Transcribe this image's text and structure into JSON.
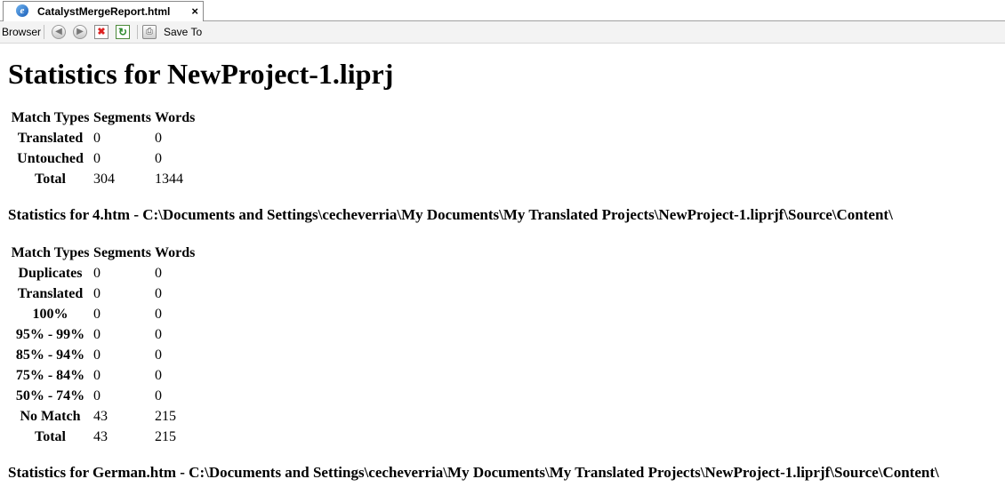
{
  "tab": {
    "title": "CatalystMergeReport.html",
    "close_glyph": "×"
  },
  "toolbar": {
    "browser_label": "Browser",
    "back_icon": "back-arrow-icon",
    "forward_icon": "forward-arrow-icon",
    "stop_icon": "stop-icon",
    "refresh_icon": "refresh-icon",
    "print_icon": "print-icon",
    "save_to_label": "Save To"
  },
  "report": {
    "title": "Statistics for NewProject-1.liprj",
    "summary": {
      "headers": [
        "Match Types",
        "Segments",
        "Words"
      ],
      "rows": [
        [
          "Translated",
          "0",
          "0"
        ],
        [
          "Untouched",
          "0",
          "0"
        ],
        [
          "Total",
          "304",
          "1344"
        ]
      ]
    },
    "files": [
      {
        "heading": "Statistics for 4.htm - C:\\Documents and Settings\\cecheverria\\My Documents\\My Translated Projects\\NewProject-1.liprjf\\Source\\Content\\",
        "headers": [
          "Match Types",
          "Segments",
          "Words"
        ],
        "rows": [
          [
            "Duplicates",
            "0",
            "0"
          ],
          [
            "Translated",
            "0",
            "0"
          ],
          [
            "100%",
            "0",
            "0"
          ],
          [
            "95% - 99%",
            "0",
            "0"
          ],
          [
            "85% - 94%",
            "0",
            "0"
          ],
          [
            "75% - 84%",
            "0",
            "0"
          ],
          [
            "50% - 74%",
            "0",
            "0"
          ],
          [
            "No Match",
            "43",
            "215"
          ],
          [
            "Total",
            "43",
            "215"
          ]
        ]
      },
      {
        "heading": "Statistics for German.htm - C:\\Documents and Settings\\cecheverria\\My Documents\\My Translated Projects\\NewProject-1.liprjf\\Source\\Content\\"
      }
    ]
  }
}
